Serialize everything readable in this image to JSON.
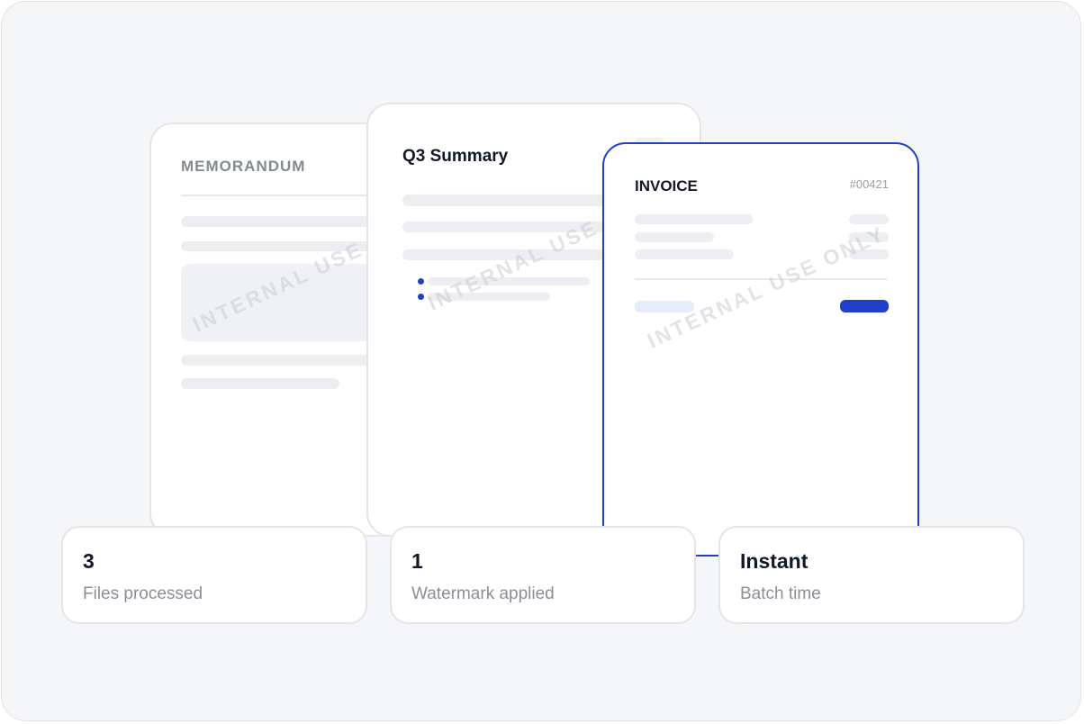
{
  "documents": {
    "memorandum": {
      "title": "MEMORANDUM",
      "watermark": "INTERNAL USE"
    },
    "summary": {
      "title": "Q3 Summary",
      "watermark": "INTERNAL USE"
    },
    "invoice": {
      "title": "INVOICE",
      "number": "#00421",
      "watermark": "INTERNAL USE ONLY"
    }
  },
  "stats": [
    {
      "value": "3",
      "label": "Files processed"
    },
    {
      "value": "1",
      "label": "Watermark applied"
    },
    {
      "value": "Instant",
      "label": "Batch time"
    }
  ],
  "colors": {
    "accent": "#1f3fc7",
    "background": "#f5f6f8",
    "card": "#ffffff",
    "placeholder": "#eceef2",
    "muted_text": "#8a8f98",
    "heading_text": "#111827"
  }
}
